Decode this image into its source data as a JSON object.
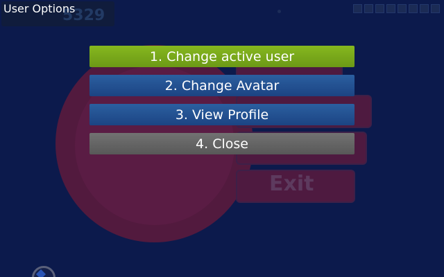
{
  "dialog": {
    "title": "User Options",
    "menu": [
      {
        "label": "1. Change active user",
        "state": "selected"
      },
      {
        "label": "2. Change Avatar",
        "state": "normal"
      },
      {
        "label": "3. View Profile",
        "state": "normal"
      },
      {
        "label": "4. Close",
        "state": "close"
      }
    ]
  },
  "background": {
    "score_partial": "5329",
    "exit_button_label": "Exit"
  },
  "colors": {
    "backdrop": "#0c1a4c",
    "selected_item": "#7aab1b",
    "normal_item": "#2a5b9b",
    "close_item": "#6b6b6b",
    "text": "#ffffff"
  }
}
